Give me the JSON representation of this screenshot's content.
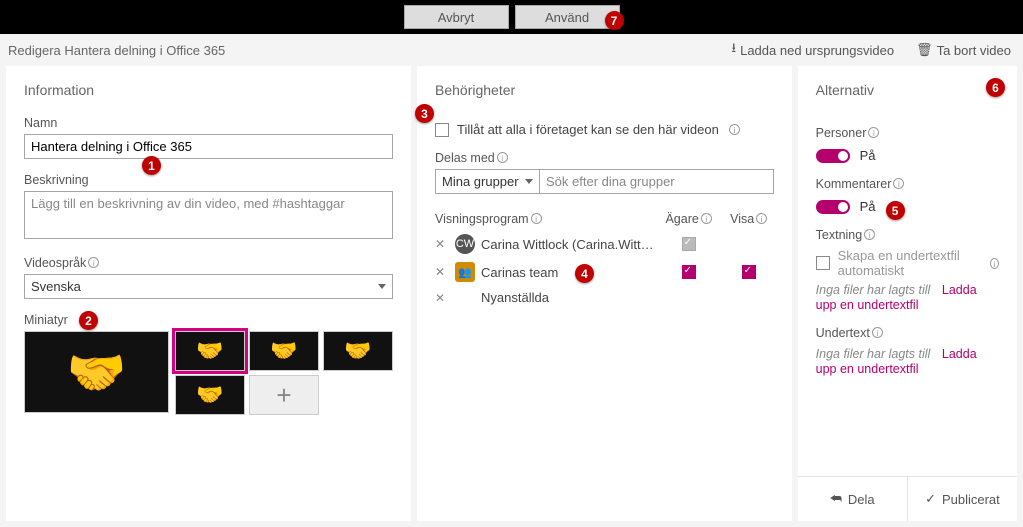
{
  "topbar": {
    "cancel": "Avbryt",
    "apply": "Använd"
  },
  "toolbar": {
    "title": "Redigera Hantera delning i Office 365",
    "download": "Ladda ned ursprungsvideo",
    "delete": "Ta bort video"
  },
  "info": {
    "heading": "Information",
    "name_label": "Namn",
    "name_value": "Hantera delning i Office 365",
    "desc_label": "Beskrivning",
    "desc_placeholder": "Lägg till en beskrivning av din video, med #hashtaggar",
    "lang_label": "Videospråk",
    "lang_value": "Svenska",
    "thumb_label": "Miniatyr"
  },
  "perm": {
    "heading": "Behörigheter",
    "allow_all": "Tillåt att alla i företaget kan se den här videon",
    "share_label": "Delas med",
    "group_select": "Mina grupper",
    "group_search_ph": "Sök efter dina grupper",
    "viewers_label": "Visningsprogram",
    "owner_label": "Ägare",
    "view_label": "Visa",
    "rows": [
      {
        "name": "Carina Wittlock (Carina.Witt…",
        "avatar": "CW",
        "team": false,
        "owner": "dim",
        "view": ""
      },
      {
        "name": "Carinas team",
        "avatar": "👥",
        "team": true,
        "owner": "on",
        "view": "on"
      },
      {
        "name": "Nyanställda",
        "avatar": "",
        "team": false,
        "owner": "",
        "view": ""
      }
    ]
  },
  "opt": {
    "heading": "Alternativ",
    "people_label": "Personer",
    "comments_label": "Kommentarer",
    "on": "På",
    "cc_label": "Textning",
    "cc_auto": "Skapa en undertextfil automatiskt",
    "nofiles": "Inga filer har lagts till",
    "upload": "Ladda upp en undertextfil",
    "subtitle_label": "Undertext",
    "share": "Dela",
    "published": "Publicerat"
  },
  "callouts": {
    "c1": "1",
    "c2": "2",
    "c3": "3",
    "c4": "4",
    "c5": "5",
    "c6": "6",
    "c7": "7"
  }
}
